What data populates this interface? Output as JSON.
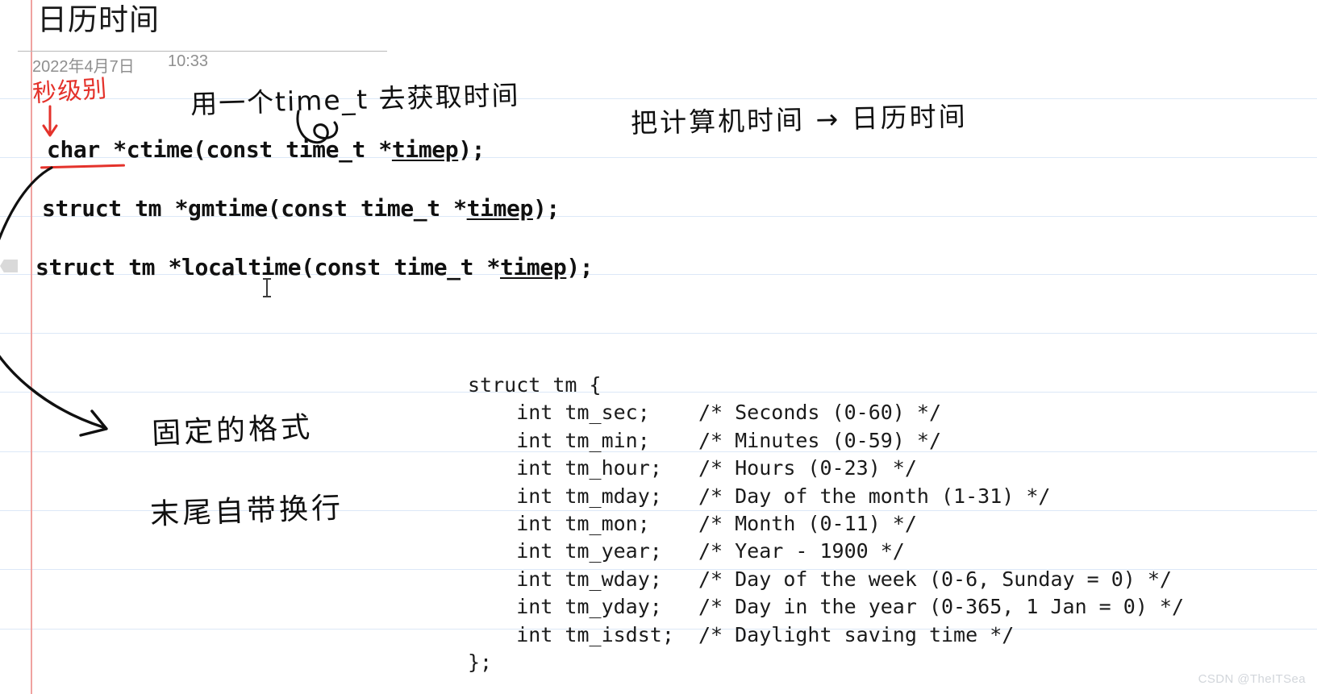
{
  "page": {
    "title": "日历时间",
    "date": "2022年4月7日",
    "time": "10:33",
    "watermark": "CSDN @TheITSea",
    "colors": {
      "ruled_line": "#dce8f7",
      "margin_line": "#f0a2a0",
      "red_ink": "#e4322b",
      "black_ink": "#101010",
      "meta_text": "#8f8f8f",
      "watermark": "#d2d6db"
    }
  },
  "prototypes": [
    {
      "id": "ctime",
      "pre": "char *ctime(const time_t *",
      "underlined": "timep",
      "post": ");"
    },
    {
      "id": "gmtime",
      "pre": "struct tm *gmtime(const time_t *",
      "underlined": "timep",
      "post": ");"
    },
    {
      "id": "localtime",
      "pre": "struct tm *localtime(const time_t *",
      "underlined": "timep",
      "post": ");"
    }
  ],
  "ghost_text": "  ..   -       .          . .",
  "struct_tm": {
    "open": "struct tm {",
    "close": "};",
    "fields": [
      {
        "decl": "int tm_sec;",
        "comment": "/* Seconds (0-60) */"
      },
      {
        "decl": "int tm_min;",
        "comment": "/* Minutes (0-59) */"
      },
      {
        "decl": "int tm_hour;",
        "comment": "/* Hours (0-23) */"
      },
      {
        "decl": "int tm_mday;",
        "comment": "/* Day of the month (1-31) */"
      },
      {
        "decl": "int tm_mon;",
        "comment": "/* Month (0-11) */"
      },
      {
        "decl": "int tm_year;",
        "comment": "/* Year - 1900 */"
      },
      {
        "decl": "int tm_wday;",
        "comment": "/* Day of the week (0-6, Sunday = 0) */"
      },
      {
        "decl": "int tm_yday;",
        "comment": "/* Day in the year (0-365, 1 Jan = 0) */"
      },
      {
        "decl": "int tm_isdst;",
        "comment": "/* Daylight saving time */"
      }
    ],
    "full_text": "struct tm {\n    int tm_sec;    /* Seconds (0-60) */\n    int tm_min;    /* Minutes (0-59) */\n    int tm_hour;   /* Hours (0-23) */\n    int tm_mday;   /* Day of the month (1-31) */\n    int tm_mon;    /* Month (0-11) */\n    int tm_year;   /* Year - 1900 */\n    int tm_wday;   /* Day of the week (0-6, Sunday = 0) */\n    int tm_yday;   /* Day in the year (0-365, 1 Jan = 0) */\n    int tm_isdst;  /* Daylight saving time */\n};"
  },
  "annotations": {
    "red_note": "秒级别",
    "time_t_note": "用一个time_t 去获取时间",
    "convert_note": "把计算机时间 → 日历时间",
    "fixed_format_note": "固定的格式",
    "newline_note": "末尾自带换行"
  }
}
